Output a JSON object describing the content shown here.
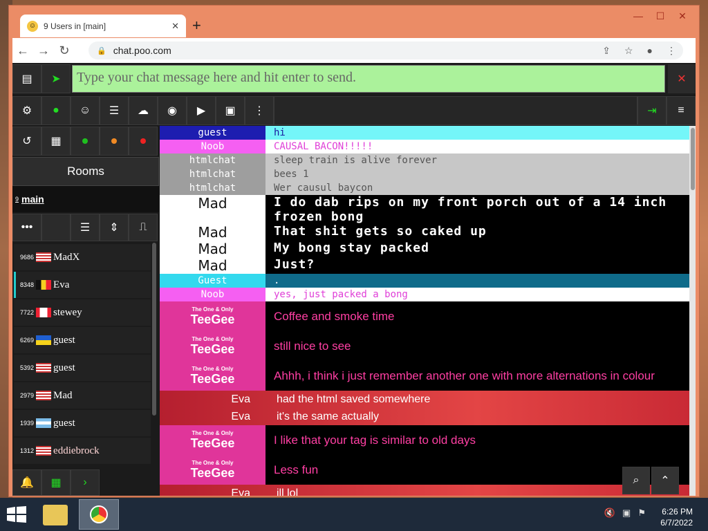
{
  "browser": {
    "tab_title": "9 Users in [main]",
    "tab_close": "✕",
    "new_tab": "+",
    "url": "chat.poo.com"
  },
  "composer": {
    "placeholder": "Type your chat message here and hit enter to send.",
    "clear": "✕"
  },
  "sidebar": {
    "rooms_label": "Rooms",
    "room": {
      "count": "9",
      "name": "main"
    },
    "users": [
      {
        "count": "9686",
        "name": "MadX",
        "flag": "us",
        "color": "#ffffff"
      },
      {
        "count": "8348",
        "name": "Eva",
        "flag": "be",
        "color": "#ffffff"
      },
      {
        "count": "7722",
        "name": "stewey",
        "flag": "ca",
        "color": "#ffffff"
      },
      {
        "count": "6269",
        "name": "guest",
        "flag": "ua",
        "color": "#ffffff"
      },
      {
        "count": "5392",
        "name": "guest",
        "flag": "us",
        "color": "#ffffff"
      },
      {
        "count": "2979",
        "name": "Mad",
        "flag": "us",
        "color": "#ffffff"
      },
      {
        "count": "1939",
        "name": "guest",
        "flag": "ar",
        "color": "#ffffff"
      },
      {
        "count": "1312",
        "name": "eddiebrock",
        "flag": "us",
        "color": "#ffd6d6"
      }
    ]
  },
  "messages": [
    {
      "style": "mono",
      "name": "guest",
      "text": "hi",
      "name_bg": "#1d1db0",
      "name_fg": "#ffffff",
      "text_bg": "#74f6f9",
      "text_fg": "#1a1aa0"
    },
    {
      "style": "mono",
      "name": "Noob",
      "text": "CAUSAL BACON!!!!!",
      "name_bg": "#f55ff2",
      "name_fg": "#ffffff",
      "text_bg": "#ffffff",
      "text_fg": "#e040d8"
    },
    {
      "style": "mono",
      "name": "htmlchat",
      "text": "sleep train is alive forever",
      "name_bg": "#9e9e9e",
      "name_fg": "#ffffff",
      "text_bg": "#c7c7c7",
      "text_fg": "#555555"
    },
    {
      "style": "mono",
      "name": "htmlchat",
      "text": "bees 1",
      "name_bg": "#9e9e9e",
      "name_fg": "#ffffff",
      "text_bg": "#c7c7c7",
      "text_fg": "#555555"
    },
    {
      "style": "mono",
      "name": "htmlchat",
      "text": "Wer causul baycon",
      "name_bg": "#9e9e9e",
      "name_fg": "#ffffff",
      "text_bg": "#c7c7c7",
      "text_fg": "#555555"
    },
    {
      "style": "mad",
      "name": "Mad",
      "text": "I do dab rips on my front porch out of a 14 inch frozen bong"
    },
    {
      "style": "mad",
      "name": "Mad",
      "text": "That shit gets so caked up"
    },
    {
      "style": "mad",
      "name": "Mad",
      "text": "My bong stay packed"
    },
    {
      "style": "mad",
      "name": "Mad",
      "text": "Just?"
    },
    {
      "style": "mono",
      "name": "Guest",
      "text": ".",
      "name_bg": "#33d9ee",
      "name_fg": "#ffffff",
      "text_bg": "#0f6b8a",
      "text_fg": "#ffffff"
    },
    {
      "style": "mono",
      "name": "Noob",
      "text": "yes, just packed a bong",
      "name_bg": "#f55ff2",
      "name_fg": "#ffffff",
      "text_bg": "#ffffff",
      "text_fg": "#e040d8"
    },
    {
      "style": "tg",
      "tag": "The One & Only",
      "name": "TeeGee",
      "text": "Coffee and smoke time"
    },
    {
      "style": "tg",
      "tag": "The One & Only",
      "name": "TeeGee",
      "text": "still nice to see"
    },
    {
      "style": "tg",
      "tag": "The One & Only",
      "name": "TeeGee",
      "text": "Ahhh, i think i just remember another one with more alternations in colour"
    },
    {
      "style": "eva",
      "name": "Eva",
      "text": "had the html saved somewhere"
    },
    {
      "style": "eva",
      "name": "Eva",
      "text": "it's the same actually"
    },
    {
      "style": "tg",
      "tag": "The One & Only",
      "name": "TeeGee",
      "text": "I like that your tag is similar to old days"
    },
    {
      "style": "tg",
      "tag": "The One & Only",
      "name": "TeeGee",
      "text": "Less fun"
    },
    {
      "style": "eva",
      "name": "Eva",
      "text": "ill lol"
    }
  ],
  "taskbar": {
    "time": "6:26 PM",
    "date": "6/7/2022"
  }
}
